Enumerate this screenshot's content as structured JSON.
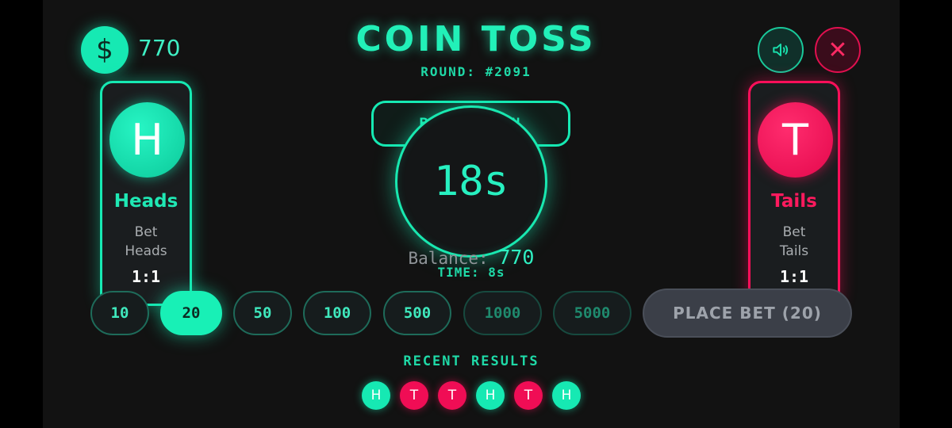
{
  "header": {
    "currency_symbol": "$",
    "balance": "770",
    "title": "COIN TOSS",
    "round": "ROUND: #2091"
  },
  "controls": {
    "sound_icon": "speaker-icon",
    "close_icon": "close-icon",
    "close_glyph": "✕"
  },
  "heads_card": {
    "letter": "H",
    "name": "Heads",
    "desc_line1": "Bet",
    "desc_line2": "Heads",
    "odds": "1:1",
    "color": "#16e9b3"
  },
  "tails_card": {
    "letter": "T",
    "name": "Tails",
    "desc_line1": "Bet",
    "desc_line2": "Tails",
    "odds": "1:1",
    "color": "#ff0f5a"
  },
  "center": {
    "status": "BETS OPEN",
    "timer": "18s",
    "balance_label": "Balance:",
    "balance_value": "770",
    "time_label": "TIME: 8s"
  },
  "chips": [
    {
      "label": "10"
    },
    {
      "label": "20"
    },
    {
      "label": "50"
    },
    {
      "label": "100"
    },
    {
      "label": "500"
    },
    {
      "label": "1000"
    },
    {
      "label": "5000"
    }
  ],
  "selected_chip": "20",
  "place_bet_label": "PLACE BET (20)",
  "recent": {
    "title": "RECENT RESULTS",
    "results": [
      "H",
      "T",
      "T",
      "H",
      "T",
      "H"
    ]
  }
}
